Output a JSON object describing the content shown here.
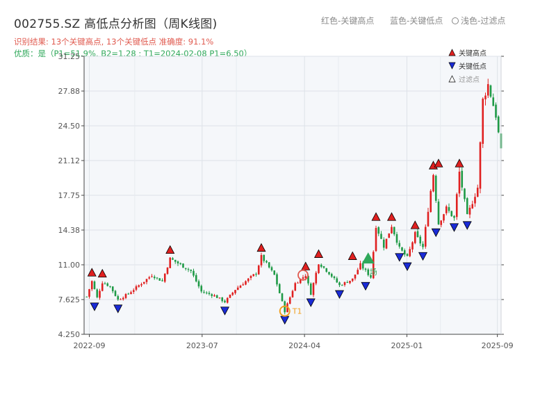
{
  "page": {
    "title": "002755.SZ 高低点分析图（周K线图)",
    "hint_high": "红色-关键高点",
    "hint_low": "蓝色-关键低点",
    "hint_filtered": "浅色-过滤点",
    "result_line": "识别结果: 13个关键高点, 13个关键低点   准确度: 91.1%",
    "quality_line": "优质：是（P1=51.9%, B2=1.28 ; T1=2024-02-08 P1=6.50）",
    "t1_label": "T1",
    "aux_label": "场"
  },
  "legend": {
    "high": "关键高点",
    "low": "关键低点",
    "filtered": "过滤点"
  },
  "colors": {
    "up": "#e02020",
    "down": "#1f9a46",
    "high_marker": "#e02020",
    "low_marker": "#1a2bd6",
    "t1": "#f0a020",
    "accent_green": "#2fa85a"
  },
  "chart_data": {
    "type": "candlestick",
    "xlabel": "",
    "ylabel": "",
    "x_axis_type": "date",
    "x_range": [
      "2022-08-18",
      "2025-09-11"
    ],
    "ylim": [
      4.25,
      31.25
    ],
    "yticks": [
      "4.250",
      "7.625",
      "11.00",
      "14.38",
      "17.75",
      "21.12",
      "24.50",
      "27.88",
      "31.25"
    ],
    "xticks": [
      "2022-09",
      "2023-07",
      "2024-04",
      "2025-01",
      "2025-09"
    ],
    "grid": true,
    "price_path": [
      [
        "2022-08-25",
        7.9
      ],
      [
        "2022-09-08",
        9.4
      ],
      [
        "2022-09-22",
        7.8
      ],
      [
        "2022-10-06",
        9.3
      ],
      [
        "2022-10-27",
        8.9
      ],
      [
        "2022-11-17",
        7.6
      ],
      [
        "2022-12-15",
        8.2
      ],
      [
        "2023-01-12",
        9.0
      ],
      [
        "2023-02-16",
        10.0
      ],
      [
        "2023-03-16",
        9.4
      ],
      [
        "2023-04-06",
        11.6
      ],
      [
        "2023-05-04",
        11.0
      ],
      [
        "2023-06-01",
        10.4
      ],
      [
        "2023-06-29",
        8.4
      ],
      [
        "2023-08-03",
        8.0
      ],
      [
        "2023-08-31",
        7.4
      ],
      [
        "2023-09-28",
        8.6
      ],
      [
        "2023-10-26",
        9.4
      ],
      [
        "2023-11-23",
        10.2
      ],
      [
        "2023-12-07",
        11.8
      ],
      [
        "2024-01-11",
        10.0
      ],
      [
        "2024-02-08",
        6.5
      ],
      [
        "2024-03-07",
        9.2
      ],
      [
        "2024-04-04",
        10.0
      ],
      [
        "2024-04-18",
        8.2
      ],
      [
        "2024-05-09",
        11.2
      ],
      [
        "2024-06-06",
        10.2
      ],
      [
        "2024-07-04",
        9.0
      ],
      [
        "2024-08-08",
        9.6
      ],
      [
        "2024-08-29",
        11.0
      ],
      [
        "2024-09-26",
        9.8
      ],
      [
        "2024-10-10",
        14.8
      ],
      [
        "2024-10-31",
        12.8
      ],
      [
        "2024-11-21",
        14.8
      ],
      [
        "2024-12-12",
        12.6
      ],
      [
        "2025-01-02",
        11.7
      ],
      [
        "2025-01-23",
        14.0
      ],
      [
        "2025-02-13",
        12.7
      ],
      [
        "2025-03-06",
        18.2
      ],
      [
        "2025-03-13",
        19.8
      ],
      [
        "2025-03-27",
        15.0
      ],
      [
        "2025-04-17",
        16.5
      ],
      [
        "2025-05-08",
        15.5
      ],
      [
        "2025-05-22",
        20.0
      ],
      [
        "2025-06-12",
        15.7
      ],
      [
        "2025-07-10",
        18.5
      ],
      [
        "2025-07-24",
        27.0
      ],
      [
        "2025-08-07",
        28.5
      ],
      [
        "2025-08-28",
        25.5
      ],
      [
        "2025-09-11",
        22.0
      ]
    ],
    "high_points": [
      [
        "2022-09-08",
        9.4
      ],
      [
        "2022-10-06",
        9.3
      ],
      [
        "2023-04-06",
        11.6
      ],
      [
        "2023-12-07",
        11.8
      ],
      [
        "2024-04-04",
        10.0
      ],
      [
        "2024-05-09",
        11.2
      ],
      [
        "2024-08-08",
        11.0
      ],
      [
        "2024-10-10",
        14.8
      ],
      [
        "2024-11-21",
        14.8
      ],
      [
        "2025-01-23",
        14.0
      ],
      [
        "2025-03-13",
        19.8
      ],
      [
        "2025-03-27",
        20.0
      ],
      [
        "2025-05-22",
        20.0
      ]
    ],
    "low_points": [
      [
        "2022-09-15",
        7.8
      ],
      [
        "2022-11-17",
        7.6
      ],
      [
        "2023-08-31",
        7.4
      ],
      [
        "2024-02-08",
        6.5
      ],
      [
        "2024-04-18",
        8.2
      ],
      [
        "2024-07-04",
        9.0
      ],
      [
        "2024-09-12",
        9.8
      ],
      [
        "2024-12-12",
        12.6
      ],
      [
        "2025-01-02",
        11.7
      ],
      [
        "2025-02-13",
        12.7
      ],
      [
        "2025-03-20",
        15.0
      ],
      [
        "2025-05-08",
        15.5
      ],
      [
        "2025-06-12",
        15.7
      ]
    ],
    "t1_point": [
      "2024-02-08",
      6.5
    ],
    "ringed_high": [
      "2024-03-28",
      10.0
    ],
    "big_marker": [
      "2024-09-19",
      11.6
    ]
  }
}
